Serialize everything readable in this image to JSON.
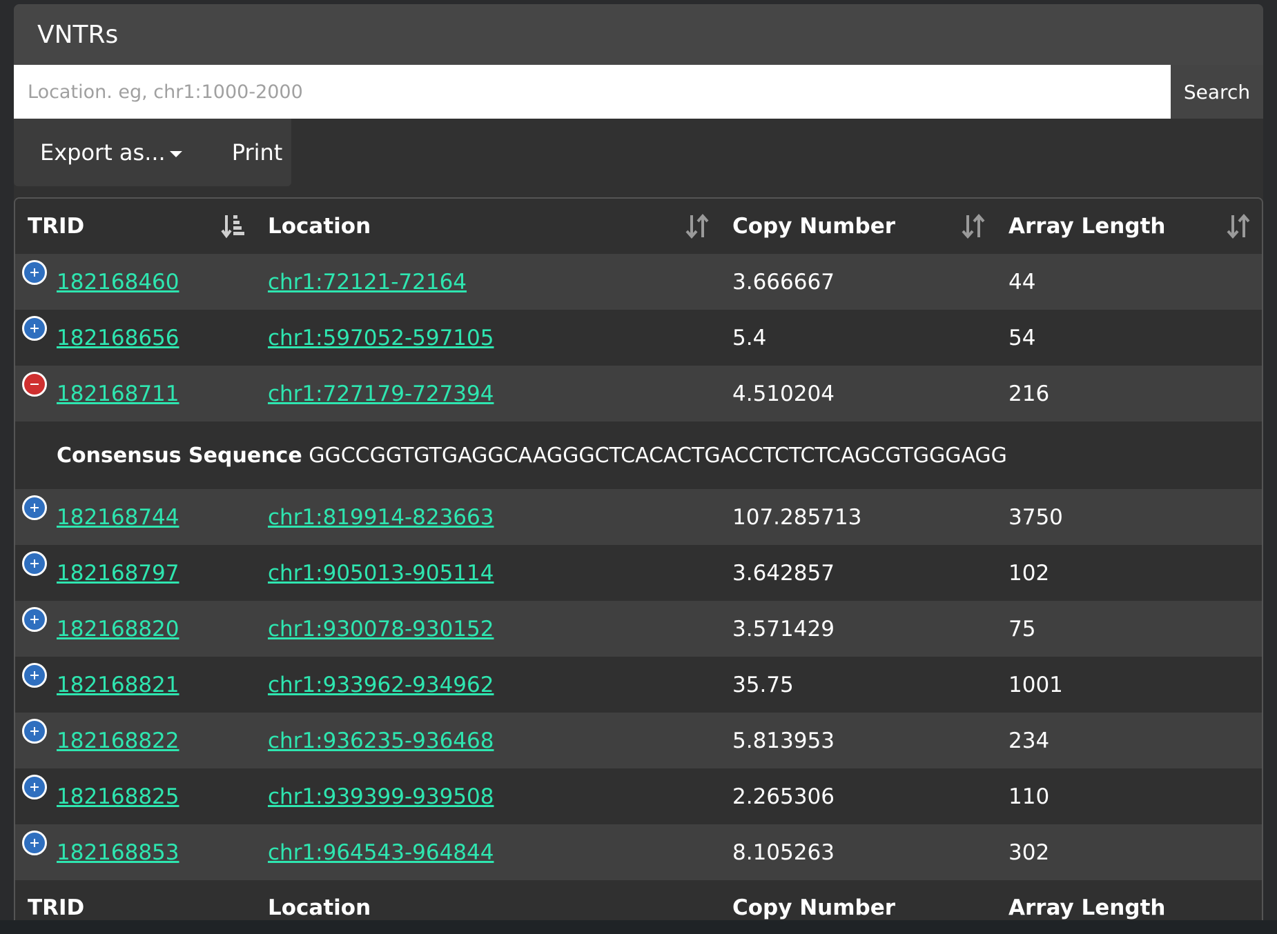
{
  "panel": {
    "title": "VNTRs"
  },
  "search": {
    "placeholder": "Location. eg, chr1:1000-2000",
    "button_label": "Search"
  },
  "toolbar": {
    "export_label": "Export as...",
    "print_label": "Print"
  },
  "table": {
    "headers": [
      "TRID",
      "Location",
      "Copy Number",
      "Array Length"
    ],
    "rows": [
      {
        "trid": "182168460",
        "location": "chr1:72121-72164",
        "copy_number": "3.666667",
        "array_length": "44",
        "expanded": false
      },
      {
        "trid": "182168656",
        "location": "chr1:597052-597105",
        "copy_number": "5.4",
        "array_length": "54",
        "expanded": false
      },
      {
        "trid": "182168711",
        "location": "chr1:727179-727394",
        "copy_number": "4.510204",
        "array_length": "216",
        "expanded": true
      },
      {
        "trid": "182168744",
        "location": "chr1:819914-823663",
        "copy_number": "107.285713",
        "array_length": "3750",
        "expanded": false
      },
      {
        "trid": "182168797",
        "location": "chr1:905013-905114",
        "copy_number": "3.642857",
        "array_length": "102",
        "expanded": false
      },
      {
        "trid": "182168820",
        "location": "chr1:930078-930152",
        "copy_number": "3.571429",
        "array_length": "75",
        "expanded": false
      },
      {
        "trid": "182168821",
        "location": "chr1:933962-934962",
        "copy_number": "35.75",
        "array_length": "1001",
        "expanded": false
      },
      {
        "trid": "182168822",
        "location": "chr1:936235-936468",
        "copy_number": "5.813953",
        "array_length": "234",
        "expanded": false
      },
      {
        "trid": "182168825",
        "location": "chr1:939399-939508",
        "copy_number": "2.265306",
        "array_length": "110",
        "expanded": false
      },
      {
        "trid": "182168853",
        "location": "chr1:964543-964844",
        "copy_number": "8.105263",
        "array_length": "302",
        "expanded": false
      }
    ],
    "details": {
      "label": "Consensus Sequence",
      "value": "GGCCGGTGTGAGGCAAGGGCTCACACTGACCTCTCTCAGCGTGGGAGG"
    },
    "footer_headers": [
      "TRID",
      "Location",
      "Copy Number",
      "Array Length"
    ]
  },
  "colors": {
    "link": "#2ee6b0",
    "expand_button": "#2f6fbf",
    "collapse_button": "#cf2f2f",
    "header_bg": "#464646",
    "row_stripe": "#404040"
  }
}
